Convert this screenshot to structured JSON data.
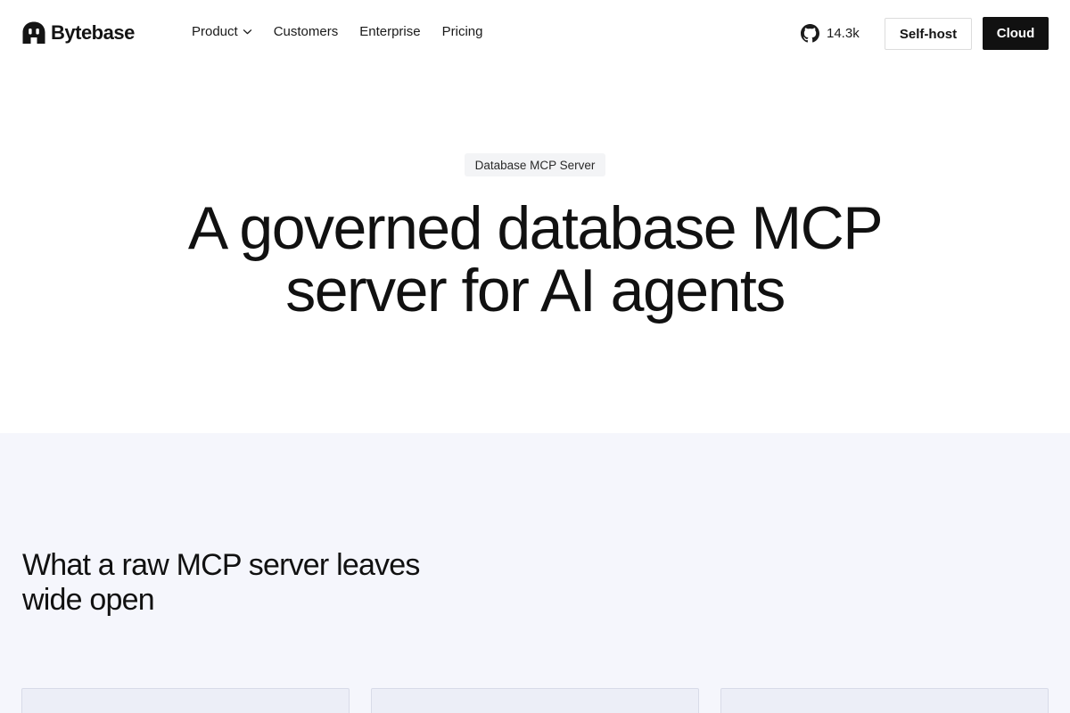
{
  "brand": {
    "name": "Bytebase",
    "logo_icon": "bytebase-logo-icon"
  },
  "nav": {
    "items": [
      {
        "label": "Product",
        "has_dropdown": true
      },
      {
        "label": "Customers",
        "has_dropdown": false
      },
      {
        "label": "Enterprise",
        "has_dropdown": false
      },
      {
        "label": "Pricing",
        "has_dropdown": false
      }
    ],
    "github": {
      "icon": "github-icon",
      "stars": "14.3k"
    },
    "self_host_label": "Self-host",
    "cloud_label": "Cloud"
  },
  "hero": {
    "badge": "Database MCP Server",
    "title_line1": "A governed database MCP",
    "title_line2": "server for AI agents"
  },
  "section": {
    "title_line1": "What a raw MCP server leaves",
    "title_line2": "wide open"
  },
  "colors": {
    "text": "#111111",
    "primary_button_bg": "#111111",
    "primary_button_text": "#ffffff",
    "section_bg": "#f5f6fc",
    "badge_bg": "#f3f4f6"
  }
}
